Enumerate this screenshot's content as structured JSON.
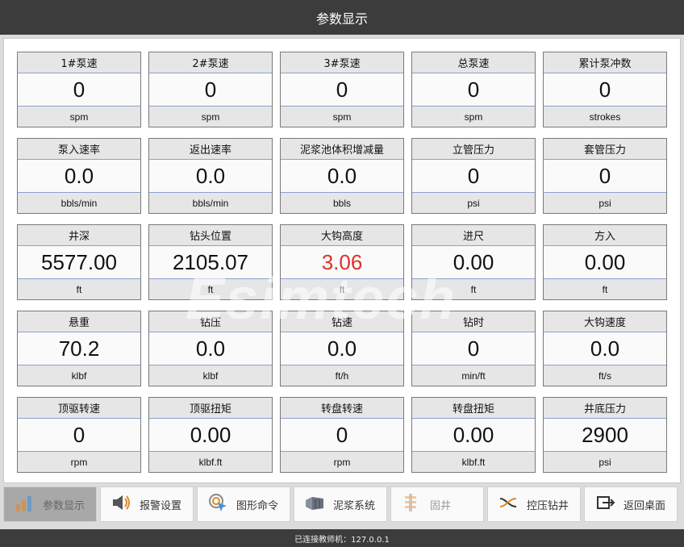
{
  "title": "参数显示",
  "watermark": "Esimtech",
  "cells": [
    {
      "label": "1#泵速",
      "value": "0",
      "unit": "spm"
    },
    {
      "label": "2#泵速",
      "value": "0",
      "unit": "spm"
    },
    {
      "label": "3#泵速",
      "value": "0",
      "unit": "spm"
    },
    {
      "label": "总泵速",
      "value": "0",
      "unit": "spm"
    },
    {
      "label": "累计泵冲数",
      "value": "0",
      "unit": "strokes"
    },
    {
      "label": "泵入速率",
      "value": "0.0",
      "unit": "bbls/min"
    },
    {
      "label": "返出速率",
      "value": "0.0",
      "unit": "bbls/min"
    },
    {
      "label": "泥浆池体积增减量",
      "value": "0.0",
      "unit": "bbls"
    },
    {
      "label": "立管压力",
      "value": "0",
      "unit": "psi"
    },
    {
      "label": "套管压力",
      "value": "0",
      "unit": "psi"
    },
    {
      "label": "井深",
      "value": "5577.00",
      "unit": "ft"
    },
    {
      "label": "钻头位置",
      "value": "2105.07",
      "unit": "ft"
    },
    {
      "label": "大钩高度",
      "value": "3.06",
      "unit": "ft",
      "highlight_color": "#e0302a"
    },
    {
      "label": "进尺",
      "value": "0.00",
      "unit": "ft"
    },
    {
      "label": "方入",
      "value": "0.00",
      "unit": "ft"
    },
    {
      "label": "悬重",
      "value": "70.2",
      "unit": "klbf"
    },
    {
      "label": "钻压",
      "value": "0.0",
      "unit": "klbf"
    },
    {
      "label": "钻速",
      "value": "0.0",
      "unit": "ft/h"
    },
    {
      "label": "钻时",
      "value": "0",
      "unit": "min/ft"
    },
    {
      "label": "大钩速度",
      "value": "0.0",
      "unit": "ft/s"
    },
    {
      "label": "顶驱转速",
      "value": "0",
      "unit": "rpm"
    },
    {
      "label": "顶驱扭矩",
      "value": "0.00",
      "unit": "klbf.ft"
    },
    {
      "label": "转盘转速",
      "value": "0",
      "unit": "rpm"
    },
    {
      "label": "转盘扭矩",
      "value": "0.00",
      "unit": "klbf.ft"
    },
    {
      "label": "井底压力",
      "value": "2900",
      "unit": "psi"
    }
  ],
  "nav": [
    {
      "label": "参数显示",
      "icon": "bar-chart-icon",
      "state": "active"
    },
    {
      "label": "报警设置",
      "icon": "speaker-icon",
      "state": "normal"
    },
    {
      "label": "图形命令",
      "icon": "target-cursor-icon",
      "state": "normal"
    },
    {
      "label": "泥浆系统",
      "icon": "tank-icon",
      "state": "normal"
    },
    {
      "label": "固井",
      "icon": "cementing-icon",
      "state": "disabled"
    },
    {
      "label": "控压钻井",
      "icon": "crossover-icon",
      "state": "normal"
    },
    {
      "label": "返回桌面",
      "icon": "exit-icon",
      "state": "normal"
    }
  ],
  "status": "已连接教师机：127.0.0.1"
}
